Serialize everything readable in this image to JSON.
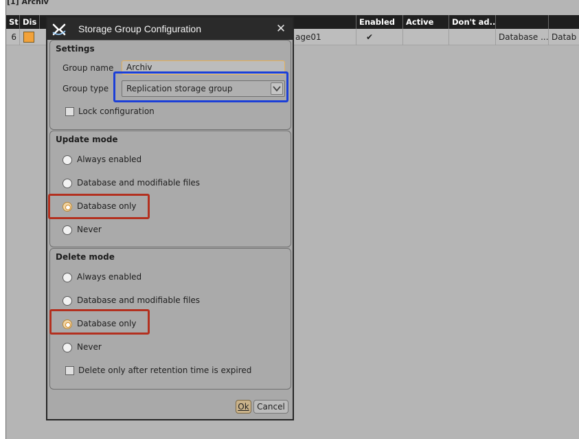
{
  "background": {
    "title": "[1] Archiv",
    "columns": [
      "St...",
      "Dis",
      "",
      "Enabled",
      "Active",
      "Don't ad...",
      "",
      ""
    ],
    "row": {
      "st": "6",
      "name_fragment": "age01",
      "enabled_mark": "✔",
      "col7": "Database ...",
      "col8": "Datab"
    }
  },
  "dialog": {
    "title": "Storage Group Configuration",
    "logo_icon": "xray-logo-icon",
    "close_icon": "close-icon",
    "settings": {
      "title": "Settings",
      "group_name_label": "Group name",
      "group_name_value": "Archiv",
      "group_type_label": "Group type",
      "group_type_value": "Replication storage group",
      "lock_label": "Lock configuration",
      "lock_checked": false
    },
    "update_mode": {
      "title": "Update mode",
      "options": [
        "Always enabled",
        "Database and modifiable files",
        "Database only",
        "Never"
      ],
      "selected_index": 2
    },
    "delete_mode": {
      "title": "Delete mode",
      "options": [
        "Always enabled",
        "Database and modifiable files",
        "Database only",
        "Never"
      ],
      "selected_index": 2,
      "retention_label": "Delete only after retention time is expired",
      "retention_checked": false
    },
    "buttons": {
      "ok": "Ok",
      "cancel": "Cancel"
    }
  },
  "colors": {
    "highlight_blue": "#1b3fd8",
    "highlight_red": "#b3301f",
    "accent_orange": "#e6b25a"
  }
}
